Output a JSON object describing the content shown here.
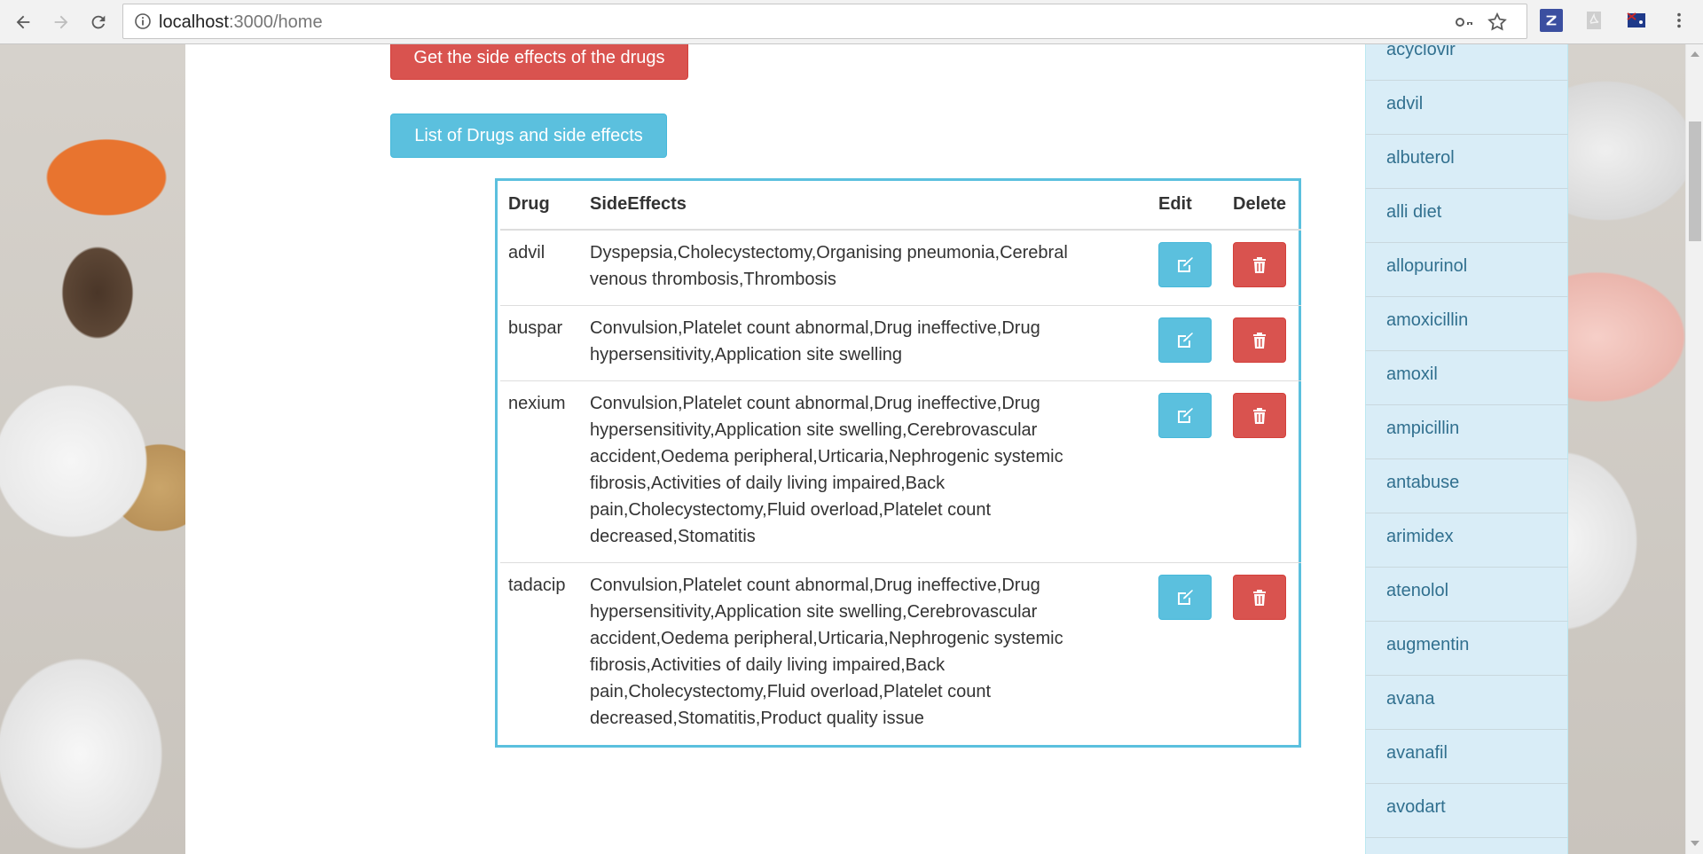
{
  "browser": {
    "url_host": "localhost",
    "url_path": ":3000/home"
  },
  "buttons": {
    "side_effects": "Get the side effects of the drugs",
    "list": "List of Drugs and side effects"
  },
  "table": {
    "headers": [
      "Drug",
      "SideEffects",
      "Edit",
      "Delete"
    ],
    "rows": [
      {
        "drug": "advil",
        "lines": [
          "Dyspepsia,Cholecystectomy,Organising pneumonia,Cerebral",
          "venous thrombosis,Thrombosis"
        ]
      },
      {
        "drug": "buspar",
        "lines": [
          "Convulsion,Platelet count abnormal,Drug ineffective,Drug",
          "hypersensitivity,Application site swelling"
        ]
      },
      {
        "drug": "nexium",
        "lines": [
          "Convulsion,Platelet count abnormal,Drug ineffective,Drug",
          "hypersensitivity,Application site swelling,Cerebrovascular",
          "accident,Oedema peripheral,Urticaria,Nephrogenic systemic",
          "fibrosis,Activities of daily living impaired,Back",
          "pain,Cholecystectomy,Fluid overload,Platelet count",
          "decreased,Stomatitis"
        ]
      },
      {
        "drug": "tadacip",
        "lines": [
          "Convulsion,Platelet count abnormal,Drug ineffective,Drug",
          "hypersensitivity,Application site swelling,Cerebrovascular",
          "accident,Oedema peripheral,Urticaria,Nephrogenic systemic",
          "fibrosis,Activities of daily living impaired,Back",
          "pain,Cholecystectomy,Fluid overload,Platelet count",
          "decreased,Stomatitis,Product quality issue"
        ]
      }
    ]
  },
  "sidebar": {
    "items": [
      "acyclovir",
      "advil",
      "albuterol",
      "alli diet",
      "allopurinol",
      "amoxicillin",
      "amoxil",
      "ampicillin",
      "antabuse",
      "arimidex",
      "atenolol",
      "augmentin",
      "avana",
      "avanafil",
      "avodart",
      ""
    ]
  },
  "colors": {
    "danger": "#d9534f",
    "info": "#5bc0de",
    "list_bg": "#d9edf7",
    "list_text": "#31708f"
  }
}
